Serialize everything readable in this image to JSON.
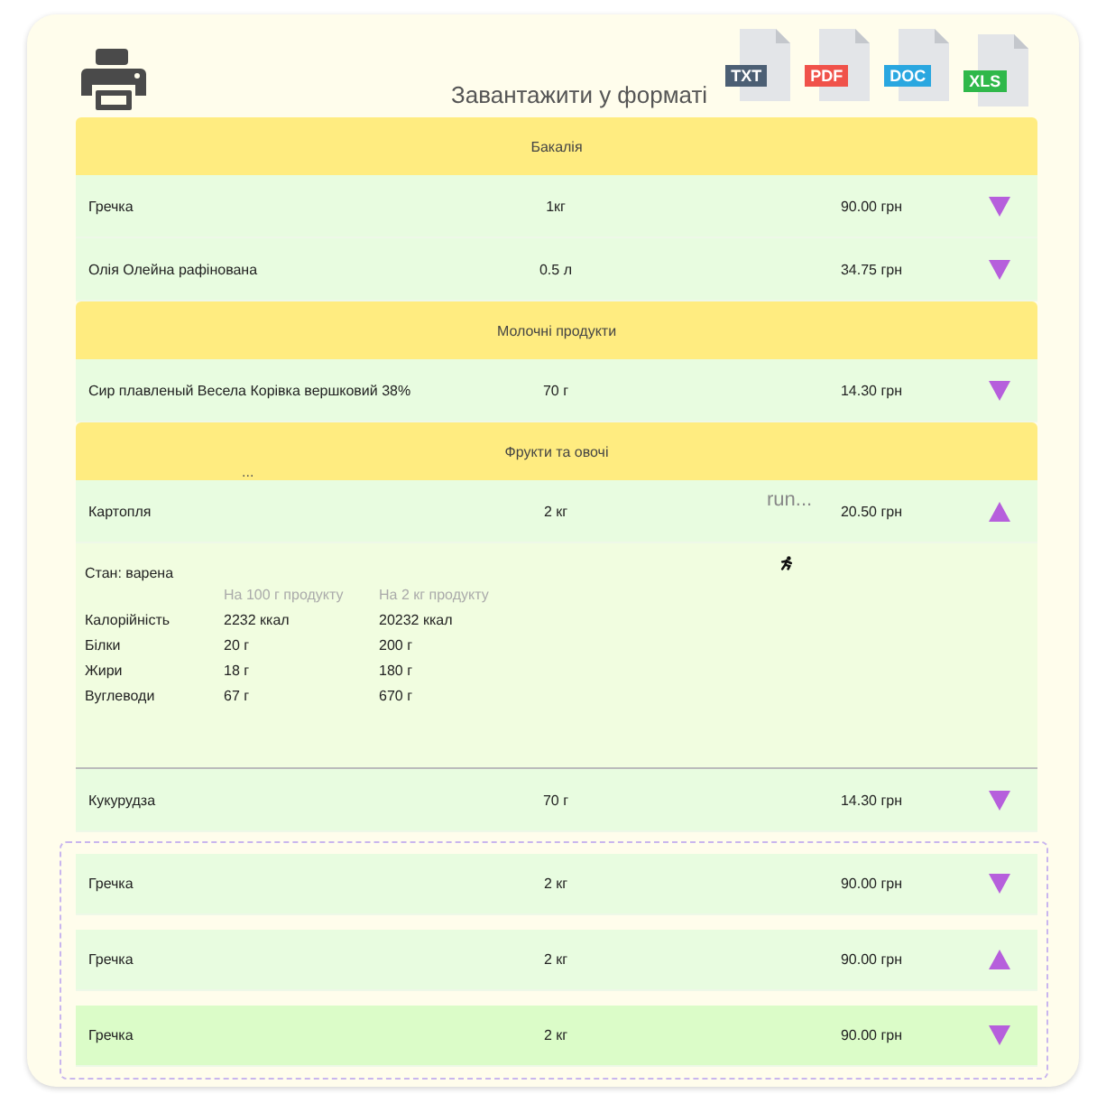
{
  "header": {
    "title": "Завантажити у форматі",
    "formats": [
      {
        "label": "TXT",
        "color": "#4c5f74"
      },
      {
        "label": "PDF",
        "color": "#f0524a"
      },
      {
        "label": "DOC",
        "color": "#2aa7e0"
      },
      {
        "label": "XLS",
        "color": "#2fb84a"
      }
    ]
  },
  "categories": [
    {
      "name": "Бакалія",
      "items": [
        {
          "name": "Гречка",
          "quantity": "1кг",
          "price": "90.00 грн",
          "expanded": false
        },
        {
          "name": "Олія Олейна рафінована",
          "quantity": "0.5 л",
          "price": "34.75 грн",
          "expanded": false
        }
      ]
    },
    {
      "name": "Молочні продукти",
      "items": [
        {
          "name": "Сир плавленый Весела Корівка вершковий 38%",
          "quantity": "70 г",
          "price": "14.30 грн",
          "expanded": false
        }
      ]
    },
    {
      "name": "Фрукти та овочі",
      "note": "...",
      "items": [
        {
          "name": "Картопля",
          "quantity": "2 кг",
          "price": "20.50 грн",
          "expanded": true,
          "status": "run...",
          "details": {
            "state": "Стан: варена",
            "columns": [
              "На 100 г продукту",
              "На 2 кг продукту"
            ],
            "rows": [
              {
                "label": "Калорійність",
                "per_100": "2232 ккал",
                "total": "20232 ккал"
              },
              {
                "label": "Білки",
                "per_100": "20 г",
                "total": "200 г"
              },
              {
                "label": "Жири",
                "per_100": "18 г",
                "total": "180 г"
              },
              {
                "label": "Вуглеводи",
                "per_100": "67 г",
                "total": "670 г"
              }
            ]
          }
        },
        {
          "name": "Кукурудза",
          "quantity": "70 г",
          "price": "14.30 грн",
          "expanded": false
        }
      ]
    }
  ],
  "drop_zone": {
    "items": [
      {
        "name": "Гречка",
        "quantity": "2 кг",
        "price": "90.00 грн",
        "expanded": false,
        "selected": false
      },
      {
        "name": "Гречка",
        "quantity": "2 кг",
        "price": "90.00 грн",
        "expanded": true,
        "selected": false
      },
      {
        "name": "Гречка",
        "quantity": "2 кг",
        "price": "90.00 грн",
        "expanded": false,
        "selected": true
      }
    ]
  }
}
